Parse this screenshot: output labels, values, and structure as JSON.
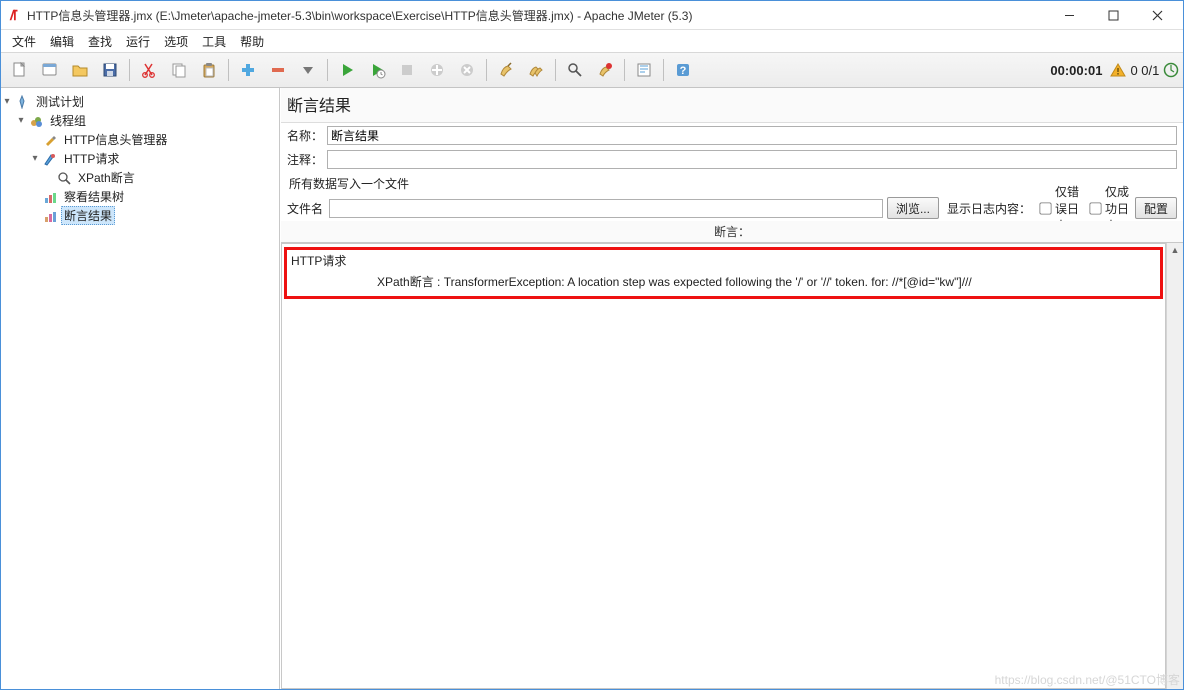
{
  "window": {
    "title": "HTTP信息头管理器.jmx (E:\\Jmeter\\apache-jmeter-5.3\\bin\\workspace\\Exercise\\HTTP信息头管理器.jmx) - Apache JMeter (5.3)"
  },
  "menubar": [
    "文件",
    "编辑",
    "查找",
    "运行",
    "选项",
    "工具",
    "帮助"
  ],
  "toolbar_icons": [
    "new-file",
    "open-templates",
    "open-folder",
    "save",
    "",
    "cut",
    "copy",
    "paste",
    "",
    "expand",
    "collapse",
    "toggle",
    "",
    "run",
    "run-no-timers",
    "stop",
    "shutdown",
    "stop-remote",
    "",
    "clear",
    "clear-all",
    "",
    "search",
    "reset-search",
    "",
    "function-helper",
    "",
    "help",
    "help-blue"
  ],
  "status": {
    "timer": "00:00:01",
    "warn_count": "0",
    "run_count": "0/1"
  },
  "tree": {
    "plan": "测试计划",
    "thread_group": "线程组",
    "header_mgr": "HTTP信息头管理器",
    "http_req": "HTTP请求",
    "xpath": "XPath断言",
    "view_tree": "察看结果树",
    "assert_res": "断言结果"
  },
  "panel": {
    "title": "断言结果",
    "name_label": "名称：",
    "name_value": "断言结果",
    "comment_label": "注释：",
    "comment_value": "",
    "write_all": "所有数据写入一个文件",
    "filename_label": "文件名",
    "filename_value": "",
    "browse": "浏览...",
    "show_log": "显示日志内容：",
    "only_error": "仅错误日志",
    "only_success": "仅成功日志",
    "configure": "配置",
    "assert_header": "断言："
  },
  "result": {
    "sampler": "HTTP请求",
    "message": "XPath断言 : TransformerException: A location step was expected following the '/' or '//' token. for: //*[@id=\"kw\"]///"
  },
  "watermark": "https://blog.csdn.net/@51CTO博客"
}
